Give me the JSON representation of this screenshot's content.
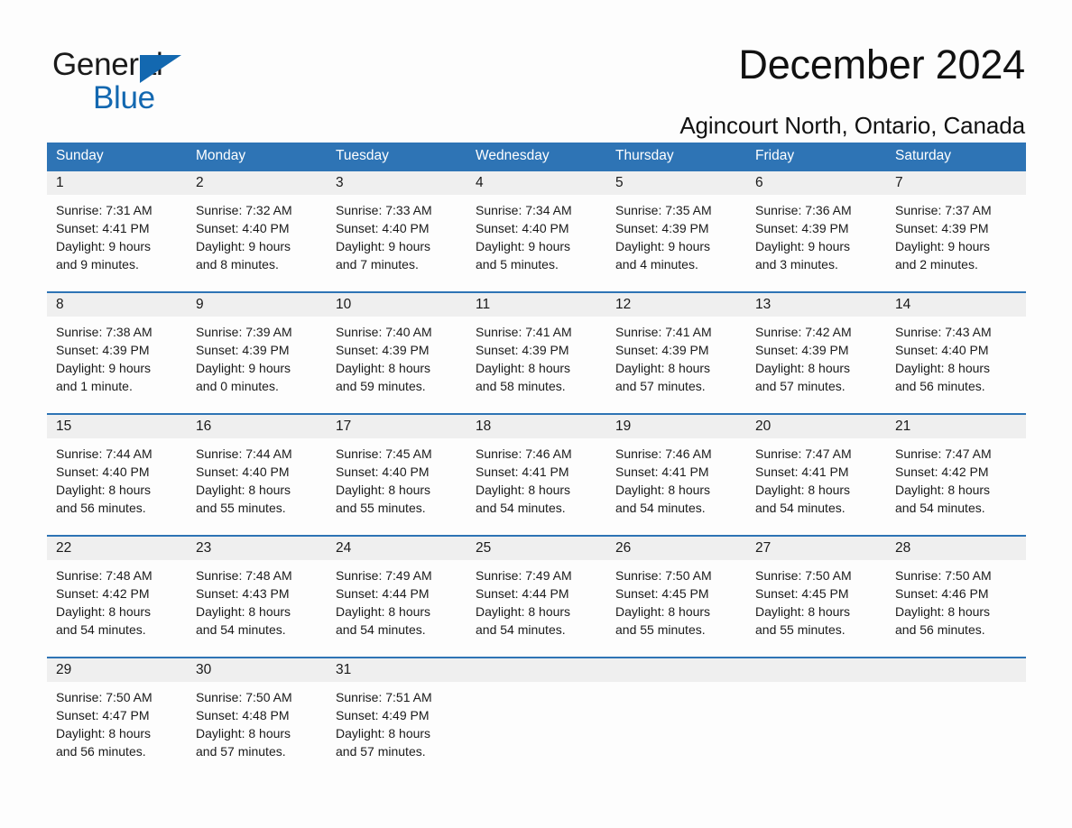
{
  "brand": {
    "name_part1": "General",
    "name_part2": "Blue",
    "accent_color": "#1368b0"
  },
  "header": {
    "month_title": "December 2024",
    "location": "Agincourt North, Ontario, Canada"
  },
  "colors": {
    "header_blue": "#2e74b5",
    "daynum_band": "#efefef",
    "text": "#1a1a1a"
  },
  "calendar": {
    "weekday_headers": [
      "Sunday",
      "Monday",
      "Tuesday",
      "Wednesday",
      "Thursday",
      "Friday",
      "Saturday"
    ],
    "weeks": [
      [
        {
          "day": "1",
          "sunrise": "Sunrise: 7:31 AM",
          "sunset": "Sunset: 4:41 PM",
          "daylight_line1": "Daylight: 9 hours",
          "daylight_line2": "and 9 minutes."
        },
        {
          "day": "2",
          "sunrise": "Sunrise: 7:32 AM",
          "sunset": "Sunset: 4:40 PM",
          "daylight_line1": "Daylight: 9 hours",
          "daylight_line2": "and 8 minutes."
        },
        {
          "day": "3",
          "sunrise": "Sunrise: 7:33 AM",
          "sunset": "Sunset: 4:40 PM",
          "daylight_line1": "Daylight: 9 hours",
          "daylight_line2": "and 7 minutes."
        },
        {
          "day": "4",
          "sunrise": "Sunrise: 7:34 AM",
          "sunset": "Sunset: 4:40 PM",
          "daylight_line1": "Daylight: 9 hours",
          "daylight_line2": "and 5 minutes."
        },
        {
          "day": "5",
          "sunrise": "Sunrise: 7:35 AM",
          "sunset": "Sunset: 4:39 PM",
          "daylight_line1": "Daylight: 9 hours",
          "daylight_line2": "and 4 minutes."
        },
        {
          "day": "6",
          "sunrise": "Sunrise: 7:36 AM",
          "sunset": "Sunset: 4:39 PM",
          "daylight_line1": "Daylight: 9 hours",
          "daylight_line2": "and 3 minutes."
        },
        {
          "day": "7",
          "sunrise": "Sunrise: 7:37 AM",
          "sunset": "Sunset: 4:39 PM",
          "daylight_line1": "Daylight: 9 hours",
          "daylight_line2": "and 2 minutes."
        }
      ],
      [
        {
          "day": "8",
          "sunrise": "Sunrise: 7:38 AM",
          "sunset": "Sunset: 4:39 PM",
          "daylight_line1": "Daylight: 9 hours",
          "daylight_line2": "and 1 minute."
        },
        {
          "day": "9",
          "sunrise": "Sunrise: 7:39 AM",
          "sunset": "Sunset: 4:39 PM",
          "daylight_line1": "Daylight: 9 hours",
          "daylight_line2": "and 0 minutes."
        },
        {
          "day": "10",
          "sunrise": "Sunrise: 7:40 AM",
          "sunset": "Sunset: 4:39 PM",
          "daylight_line1": "Daylight: 8 hours",
          "daylight_line2": "and 59 minutes."
        },
        {
          "day": "11",
          "sunrise": "Sunrise: 7:41 AM",
          "sunset": "Sunset: 4:39 PM",
          "daylight_line1": "Daylight: 8 hours",
          "daylight_line2": "and 58 minutes."
        },
        {
          "day": "12",
          "sunrise": "Sunrise: 7:41 AM",
          "sunset": "Sunset: 4:39 PM",
          "daylight_line1": "Daylight: 8 hours",
          "daylight_line2": "and 57 minutes."
        },
        {
          "day": "13",
          "sunrise": "Sunrise: 7:42 AM",
          "sunset": "Sunset: 4:39 PM",
          "daylight_line1": "Daylight: 8 hours",
          "daylight_line2": "and 57 minutes."
        },
        {
          "day": "14",
          "sunrise": "Sunrise: 7:43 AM",
          "sunset": "Sunset: 4:40 PM",
          "daylight_line1": "Daylight: 8 hours",
          "daylight_line2": "and 56 minutes."
        }
      ],
      [
        {
          "day": "15",
          "sunrise": "Sunrise: 7:44 AM",
          "sunset": "Sunset: 4:40 PM",
          "daylight_line1": "Daylight: 8 hours",
          "daylight_line2": "and 56 minutes."
        },
        {
          "day": "16",
          "sunrise": "Sunrise: 7:44 AM",
          "sunset": "Sunset: 4:40 PM",
          "daylight_line1": "Daylight: 8 hours",
          "daylight_line2": "and 55 minutes."
        },
        {
          "day": "17",
          "sunrise": "Sunrise: 7:45 AM",
          "sunset": "Sunset: 4:40 PM",
          "daylight_line1": "Daylight: 8 hours",
          "daylight_line2": "and 55 minutes."
        },
        {
          "day": "18",
          "sunrise": "Sunrise: 7:46 AM",
          "sunset": "Sunset: 4:41 PM",
          "daylight_line1": "Daylight: 8 hours",
          "daylight_line2": "and 54 minutes."
        },
        {
          "day": "19",
          "sunrise": "Sunrise: 7:46 AM",
          "sunset": "Sunset: 4:41 PM",
          "daylight_line1": "Daylight: 8 hours",
          "daylight_line2": "and 54 minutes."
        },
        {
          "day": "20",
          "sunrise": "Sunrise: 7:47 AM",
          "sunset": "Sunset: 4:41 PM",
          "daylight_line1": "Daylight: 8 hours",
          "daylight_line2": "and 54 minutes."
        },
        {
          "day": "21",
          "sunrise": "Sunrise: 7:47 AM",
          "sunset": "Sunset: 4:42 PM",
          "daylight_line1": "Daylight: 8 hours",
          "daylight_line2": "and 54 minutes."
        }
      ],
      [
        {
          "day": "22",
          "sunrise": "Sunrise: 7:48 AM",
          "sunset": "Sunset: 4:42 PM",
          "daylight_line1": "Daylight: 8 hours",
          "daylight_line2": "and 54 minutes."
        },
        {
          "day": "23",
          "sunrise": "Sunrise: 7:48 AM",
          "sunset": "Sunset: 4:43 PM",
          "daylight_line1": "Daylight: 8 hours",
          "daylight_line2": "and 54 minutes."
        },
        {
          "day": "24",
          "sunrise": "Sunrise: 7:49 AM",
          "sunset": "Sunset: 4:44 PM",
          "daylight_line1": "Daylight: 8 hours",
          "daylight_line2": "and 54 minutes."
        },
        {
          "day": "25",
          "sunrise": "Sunrise: 7:49 AM",
          "sunset": "Sunset: 4:44 PM",
          "daylight_line1": "Daylight: 8 hours",
          "daylight_line2": "and 54 minutes."
        },
        {
          "day": "26",
          "sunrise": "Sunrise: 7:50 AM",
          "sunset": "Sunset: 4:45 PM",
          "daylight_line1": "Daylight: 8 hours",
          "daylight_line2": "and 55 minutes."
        },
        {
          "day": "27",
          "sunrise": "Sunrise: 7:50 AM",
          "sunset": "Sunset: 4:45 PM",
          "daylight_line1": "Daylight: 8 hours",
          "daylight_line2": "and 55 minutes."
        },
        {
          "day": "28",
          "sunrise": "Sunrise: 7:50 AM",
          "sunset": "Sunset: 4:46 PM",
          "daylight_line1": "Daylight: 8 hours",
          "daylight_line2": "and 56 minutes."
        }
      ],
      [
        {
          "day": "29",
          "sunrise": "Sunrise: 7:50 AM",
          "sunset": "Sunset: 4:47 PM",
          "daylight_line1": "Daylight: 8 hours",
          "daylight_line2": "and 56 minutes."
        },
        {
          "day": "30",
          "sunrise": "Sunrise: 7:50 AM",
          "sunset": "Sunset: 4:48 PM",
          "daylight_line1": "Daylight: 8 hours",
          "daylight_line2": "and 57 minutes."
        },
        {
          "day": "31",
          "sunrise": "Sunrise: 7:51 AM",
          "sunset": "Sunset: 4:49 PM",
          "daylight_line1": "Daylight: 8 hours",
          "daylight_line2": "and 57 minutes."
        },
        {
          "day": "",
          "sunrise": "",
          "sunset": "",
          "daylight_line1": "",
          "daylight_line2": ""
        },
        {
          "day": "",
          "sunrise": "",
          "sunset": "",
          "daylight_line1": "",
          "daylight_line2": ""
        },
        {
          "day": "",
          "sunrise": "",
          "sunset": "",
          "daylight_line1": "",
          "daylight_line2": ""
        },
        {
          "day": "",
          "sunrise": "",
          "sunset": "",
          "daylight_line1": "",
          "daylight_line2": ""
        }
      ]
    ]
  }
}
